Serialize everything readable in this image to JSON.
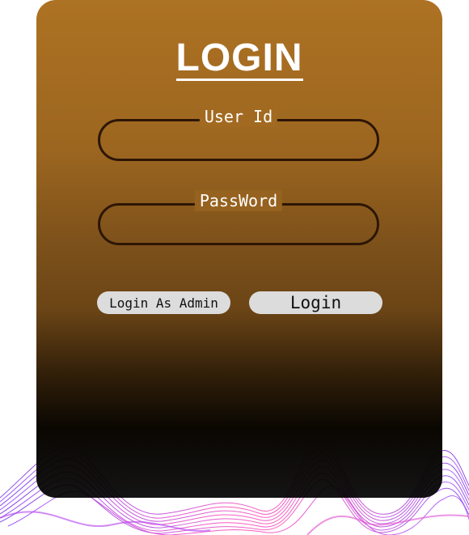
{
  "form": {
    "title": "LOGIN",
    "user_id": {
      "label": "User Id",
      "value": ""
    },
    "password": {
      "label": "PassWord",
      "value": ""
    },
    "admin_button_label": "Login As Admin",
    "login_button_label": "Login"
  },
  "colors": {
    "card_top": "#ad7223",
    "card_bottom": "#000000",
    "field_border": "#2d1606",
    "button_bg": "#dcdcdc",
    "wave_purple": "#8a3cff",
    "wave_pink": "#ff3fb4"
  },
  "icons": {
    "background": "wave-lines-decoration"
  }
}
